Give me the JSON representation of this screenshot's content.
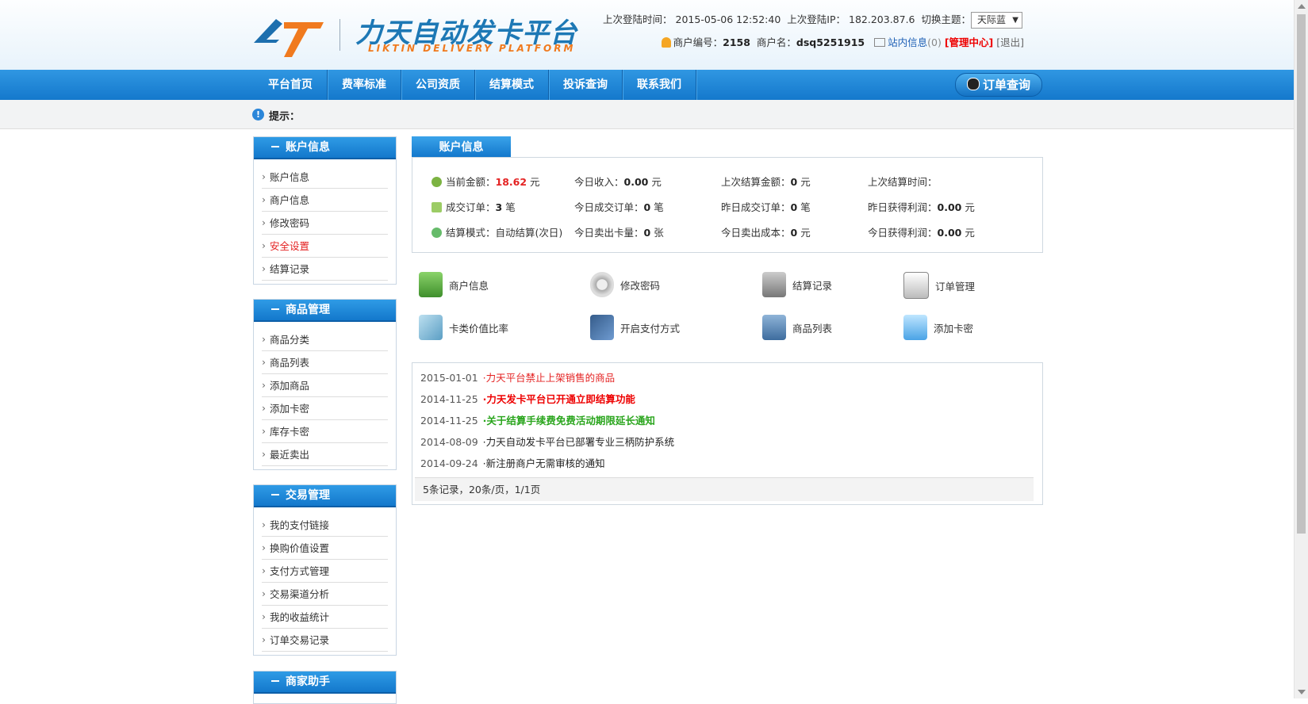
{
  "header": {
    "logo_brand": "力天自动发卡平台",
    "logo_sub": "LIKTIN DELIVERY PLATFORM",
    "last_login_time_label": "上次登陆时间：",
    "last_login_time": "2015-05-06 12:52:40",
    "last_login_ip_label": "上次登陆IP：",
    "last_login_ip": "182.203.87.6",
    "theme_label": "切换主题：",
    "theme_value": "天际蓝",
    "merchant_no_label": "商户编号：",
    "merchant_no": "2158",
    "merchant_name_label": "商户名：",
    "merchant_name": "dsq5251915",
    "message_link": "站内信息",
    "message_count": "(0)",
    "admin_link": "[管理中心]",
    "logout_link": "[退出]"
  },
  "nav": {
    "items": [
      "平台首页",
      "费率标准",
      "公司资质",
      "结算模式",
      "投诉查询",
      "联系我们"
    ],
    "order_query": "订单查询"
  },
  "tip": {
    "label": "提示："
  },
  "sidebar": {
    "sections": [
      {
        "title": "账户信息",
        "items": [
          "账户信息",
          "商户信息",
          "修改密码",
          "安全设置",
          "结算记录"
        ]
      },
      {
        "title": "商品管理",
        "items": [
          "商品分类",
          "商品列表",
          "添加商品",
          "添加卡密",
          "库存卡密",
          "最近卖出"
        ]
      },
      {
        "title": "交易管理",
        "items": [
          "我的支付链接",
          "换购价值设置",
          "支付方式管理",
          "交易渠道分析",
          "我的收益统计",
          "订单交易记录"
        ]
      },
      {
        "title": "商家助手",
        "items": []
      }
    ]
  },
  "account": {
    "tab": "账户信息",
    "balance_label": "当前金额：",
    "balance": "18.62",
    "balance_unit": "元",
    "today_income_label": "今日收入：",
    "today_income": "0.00",
    "today_income_unit": "元",
    "last_settle_amount_label": "上次结算金额：",
    "last_settle_amount": "0",
    "last_settle_amount_unit": "元",
    "last_settle_time_label": "上次结算时间：",
    "orders_label": "成交订单：",
    "orders": "3",
    "orders_unit": "笔",
    "today_orders_label": "今日成交订单：",
    "today_orders": "0",
    "today_orders_unit": "笔",
    "yesterday_orders_label": "昨日成交订单：",
    "yesterday_orders": "0",
    "yesterday_orders_unit": "笔",
    "yesterday_profit_label": "昨日获得利润：",
    "yesterday_profit": "0.00",
    "yesterday_profit_unit": "元",
    "settle_mode_label": "结算模式：",
    "settle_mode": "自动结算(次日)",
    "today_cards_label": "今日卖出卡量：",
    "today_cards": "0",
    "today_cards_unit": "张",
    "today_cost_label": "今日卖出成本：",
    "today_cost": "0",
    "today_cost_unit": "元",
    "today_profit_label": "今日获得利润：",
    "today_profit": "0.00",
    "today_profit_unit": "元"
  },
  "quick_links": [
    "商户信息",
    "修改密码",
    "结算记录",
    "订单管理",
    "卡类价值比率",
    "开启支付方式",
    "商品列表",
    "添加卡密"
  ],
  "news": {
    "rows": [
      {
        "date": "2015-01-01",
        "title": "·力天平台禁止上架销售的商品"
      },
      {
        "date": "2014-11-25",
        "title": "·力天发卡平台已开通立即结算功能"
      },
      {
        "date": "2014-11-25",
        "title": "·关于结算手续费免费活动期限延长通知"
      },
      {
        "date": "2014-08-09",
        "title": "·力天自动发卡平台已部署专业三柄防护系统"
      },
      {
        "date": "2014-09-24",
        "title": "·新注册商户无需审核的通知"
      }
    ],
    "pager": "5条记录，20条/页，1/1页"
  },
  "colors": {
    "nav_blue": "#1478cc",
    "accent_red": "#e42323",
    "green": "#2aa51d"
  }
}
